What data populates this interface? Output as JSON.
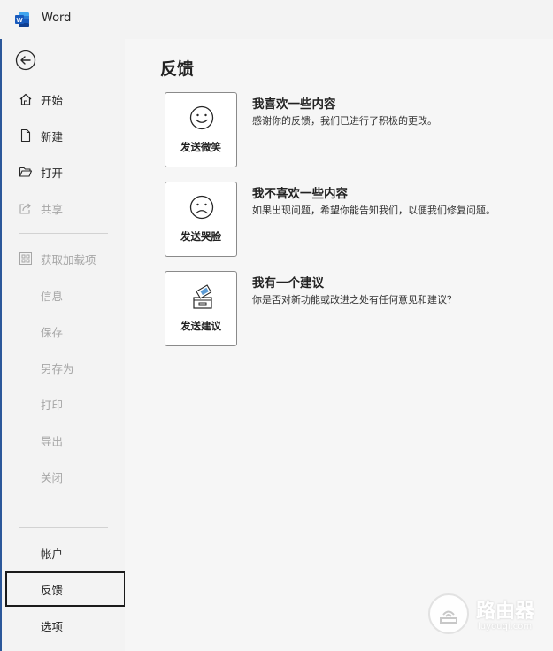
{
  "app": {
    "title": "Word"
  },
  "sidebar": {
    "items": [
      {
        "label": "开始",
        "icon": "home-icon",
        "enabled": true
      },
      {
        "label": "新建",
        "icon": "new-document-icon",
        "enabled": true
      },
      {
        "label": "打开",
        "icon": "folder-open-icon",
        "enabled": true
      },
      {
        "label": "共享",
        "icon": "share-icon",
        "enabled": false
      },
      {
        "label": "获取加载项",
        "icon": "addins-grid-icon",
        "enabled": false
      },
      {
        "label": "信息",
        "enabled": false
      },
      {
        "label": "保存",
        "enabled": false
      },
      {
        "label": "另存为",
        "enabled": false
      },
      {
        "label": "打印",
        "enabled": false
      },
      {
        "label": "导出",
        "enabled": false
      },
      {
        "label": "关闭",
        "enabled": false
      }
    ],
    "bottom": [
      {
        "label": "帐户",
        "selected": false
      },
      {
        "label": "反馈",
        "selected": true
      },
      {
        "label": "选项",
        "selected": false
      }
    ]
  },
  "main": {
    "title": "反馈",
    "options": [
      {
        "button_label": "发送微笑",
        "icon": "smile-face-icon",
        "title": "我喜欢一些内容",
        "description": "感谢你的反馈，我们已进行了积极的更改。"
      },
      {
        "button_label": "发送哭脸",
        "icon": "frown-face-icon",
        "title": "我不喜欢一些内容",
        "description": "如果出现问题，希望你能告知我们，以便我们修复问题。"
      },
      {
        "button_label": "发送建议",
        "icon": "suggestion-box-icon",
        "title": "我有一个建议",
        "description": "你是否对新功能或改进之处有任何意见和建议？"
      }
    ]
  },
  "watermark": {
    "main": "路由器",
    "sub": "luyouqi.com"
  },
  "colors": {
    "accent": "#2b579a",
    "background": "#f3f3f3",
    "disabled_text": "#a6a6a6"
  }
}
